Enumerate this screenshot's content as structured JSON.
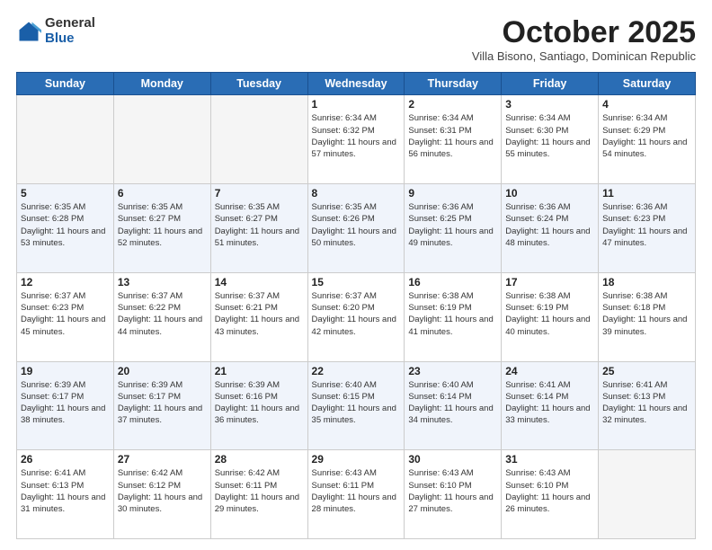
{
  "header": {
    "logo_general": "General",
    "logo_blue": "Blue",
    "month_title": "October 2025",
    "subtitle": "Villa Bisono, Santiago, Dominican Republic"
  },
  "days_of_week": [
    "Sunday",
    "Monday",
    "Tuesday",
    "Wednesday",
    "Thursday",
    "Friday",
    "Saturday"
  ],
  "weeks": [
    [
      {
        "day": "",
        "info": ""
      },
      {
        "day": "",
        "info": ""
      },
      {
        "day": "",
        "info": ""
      },
      {
        "day": "1",
        "info": "Sunrise: 6:34 AM\nSunset: 6:32 PM\nDaylight: 11 hours and 57 minutes."
      },
      {
        "day": "2",
        "info": "Sunrise: 6:34 AM\nSunset: 6:31 PM\nDaylight: 11 hours and 56 minutes."
      },
      {
        "day": "3",
        "info": "Sunrise: 6:34 AM\nSunset: 6:30 PM\nDaylight: 11 hours and 55 minutes."
      },
      {
        "day": "4",
        "info": "Sunrise: 6:34 AM\nSunset: 6:29 PM\nDaylight: 11 hours and 54 minutes."
      }
    ],
    [
      {
        "day": "5",
        "info": "Sunrise: 6:35 AM\nSunset: 6:28 PM\nDaylight: 11 hours and 53 minutes."
      },
      {
        "day": "6",
        "info": "Sunrise: 6:35 AM\nSunset: 6:27 PM\nDaylight: 11 hours and 52 minutes."
      },
      {
        "day": "7",
        "info": "Sunrise: 6:35 AM\nSunset: 6:27 PM\nDaylight: 11 hours and 51 minutes."
      },
      {
        "day": "8",
        "info": "Sunrise: 6:35 AM\nSunset: 6:26 PM\nDaylight: 11 hours and 50 minutes."
      },
      {
        "day": "9",
        "info": "Sunrise: 6:36 AM\nSunset: 6:25 PM\nDaylight: 11 hours and 49 minutes."
      },
      {
        "day": "10",
        "info": "Sunrise: 6:36 AM\nSunset: 6:24 PM\nDaylight: 11 hours and 48 minutes."
      },
      {
        "day": "11",
        "info": "Sunrise: 6:36 AM\nSunset: 6:23 PM\nDaylight: 11 hours and 47 minutes."
      }
    ],
    [
      {
        "day": "12",
        "info": "Sunrise: 6:37 AM\nSunset: 6:23 PM\nDaylight: 11 hours and 45 minutes."
      },
      {
        "day": "13",
        "info": "Sunrise: 6:37 AM\nSunset: 6:22 PM\nDaylight: 11 hours and 44 minutes."
      },
      {
        "day": "14",
        "info": "Sunrise: 6:37 AM\nSunset: 6:21 PM\nDaylight: 11 hours and 43 minutes."
      },
      {
        "day": "15",
        "info": "Sunrise: 6:37 AM\nSunset: 6:20 PM\nDaylight: 11 hours and 42 minutes."
      },
      {
        "day": "16",
        "info": "Sunrise: 6:38 AM\nSunset: 6:19 PM\nDaylight: 11 hours and 41 minutes."
      },
      {
        "day": "17",
        "info": "Sunrise: 6:38 AM\nSunset: 6:19 PM\nDaylight: 11 hours and 40 minutes."
      },
      {
        "day": "18",
        "info": "Sunrise: 6:38 AM\nSunset: 6:18 PM\nDaylight: 11 hours and 39 minutes."
      }
    ],
    [
      {
        "day": "19",
        "info": "Sunrise: 6:39 AM\nSunset: 6:17 PM\nDaylight: 11 hours and 38 minutes."
      },
      {
        "day": "20",
        "info": "Sunrise: 6:39 AM\nSunset: 6:17 PM\nDaylight: 11 hours and 37 minutes."
      },
      {
        "day": "21",
        "info": "Sunrise: 6:39 AM\nSunset: 6:16 PM\nDaylight: 11 hours and 36 minutes."
      },
      {
        "day": "22",
        "info": "Sunrise: 6:40 AM\nSunset: 6:15 PM\nDaylight: 11 hours and 35 minutes."
      },
      {
        "day": "23",
        "info": "Sunrise: 6:40 AM\nSunset: 6:14 PM\nDaylight: 11 hours and 34 minutes."
      },
      {
        "day": "24",
        "info": "Sunrise: 6:41 AM\nSunset: 6:14 PM\nDaylight: 11 hours and 33 minutes."
      },
      {
        "day": "25",
        "info": "Sunrise: 6:41 AM\nSunset: 6:13 PM\nDaylight: 11 hours and 32 minutes."
      }
    ],
    [
      {
        "day": "26",
        "info": "Sunrise: 6:41 AM\nSunset: 6:13 PM\nDaylight: 11 hours and 31 minutes."
      },
      {
        "day": "27",
        "info": "Sunrise: 6:42 AM\nSunset: 6:12 PM\nDaylight: 11 hours and 30 minutes."
      },
      {
        "day": "28",
        "info": "Sunrise: 6:42 AM\nSunset: 6:11 PM\nDaylight: 11 hours and 29 minutes."
      },
      {
        "day": "29",
        "info": "Sunrise: 6:43 AM\nSunset: 6:11 PM\nDaylight: 11 hours and 28 minutes."
      },
      {
        "day": "30",
        "info": "Sunrise: 6:43 AM\nSunset: 6:10 PM\nDaylight: 11 hours and 27 minutes."
      },
      {
        "day": "31",
        "info": "Sunrise: 6:43 AM\nSunset: 6:10 PM\nDaylight: 11 hours and 26 minutes."
      },
      {
        "day": "",
        "info": ""
      }
    ]
  ]
}
